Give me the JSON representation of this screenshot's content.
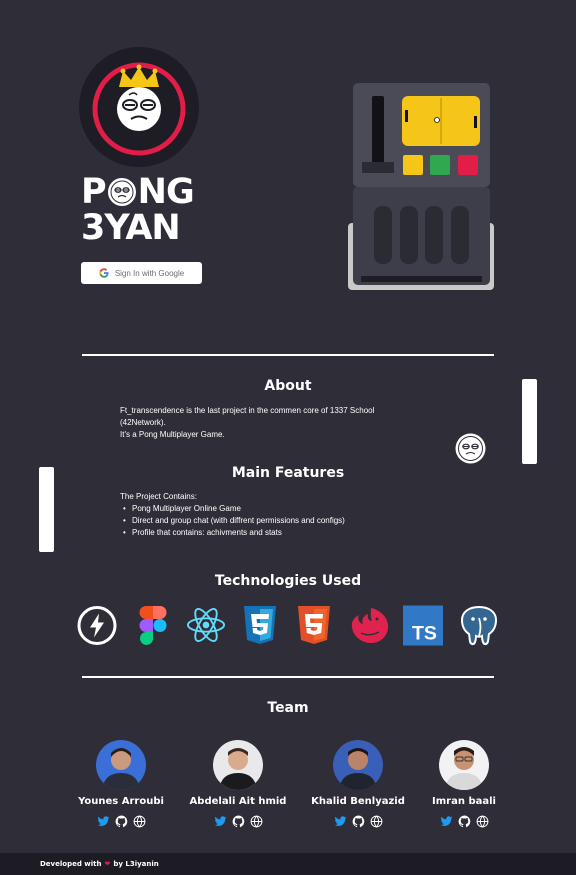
{
  "brand": {
    "line1_left": "P",
    "line1_right": "NG",
    "line2": "3YAN"
  },
  "auth": {
    "google_label": "Sign In with Google"
  },
  "about": {
    "title": "About",
    "line1": "Ft_transcendence is the last project in the commen core of 1337 School",
    "line2": "(42Network).",
    "line3": "It's a Pong Multiplayer Game."
  },
  "features": {
    "title": "Main Features",
    "intro": "The Project Contains:",
    "items": [
      "Pong Multiplayer Online Game",
      "Direct and group chat (with diffrent permissions and configs)",
      "Profile that contains: achivments and stats"
    ]
  },
  "technologies": {
    "title": "Technologies Used",
    "icons": [
      "socketio-icon",
      "figma-icon",
      "react-icon",
      "css3-icon",
      "html5-icon",
      "nestjs-icon",
      "typescript-icon",
      "postgresql-icon"
    ],
    "ts_label": "TS"
  },
  "team": {
    "title": "Team",
    "members": [
      {
        "name": "Younes Arroubi"
      },
      {
        "name": "Abdelali Ait hmid"
      },
      {
        "name": "Khalid Benlyazid"
      },
      {
        "name": "Imran baali"
      }
    ]
  },
  "footer": {
    "prefix": "Developed with",
    "heart": "❤",
    "suffix": "by L3iyanin"
  },
  "colors": {
    "background": "#2f2e38",
    "accent_red": "#e11d48",
    "accent_yellow": "#f5c518",
    "footer_bg": "#1d1c24"
  }
}
